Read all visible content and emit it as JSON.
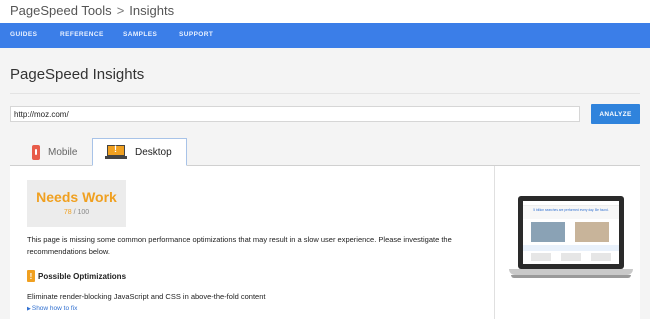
{
  "breadcrumb": {
    "root": "PageSpeed Tools",
    "separator": ">",
    "current": "Insights"
  },
  "nav": {
    "items": [
      "GUIDES",
      "REFERENCE",
      "SAMPLES",
      "SUPPORT"
    ]
  },
  "page": {
    "title": "PageSpeed Insights"
  },
  "search": {
    "url_value": "http://moz.com/",
    "analyze_label": "ANALYZE"
  },
  "tabs": {
    "mobile": "Mobile",
    "desktop": "Desktop",
    "active": "Desktop"
  },
  "result": {
    "verdict": "Needs Work",
    "score": "78",
    "score_max": "/ 100",
    "score_color": "#f0a020",
    "summary": "This page is missing some common performance optimizations that may result in a slow user experience. Please investigate the recommendations below.",
    "section_title": "Possible Optimizations",
    "rule_text": "Eliminate render-blocking JavaScript and CSS in above-the-fold content",
    "show_how_label": "Show how to fix"
  },
  "preview": {
    "headline": "5 billion searches are performed every day. Be found."
  },
  "colors": {
    "nav_bar": "#3b7ee8",
    "analyze_button": "#2f83dc",
    "warning": "#f0a020",
    "link": "#2f6fd0"
  }
}
